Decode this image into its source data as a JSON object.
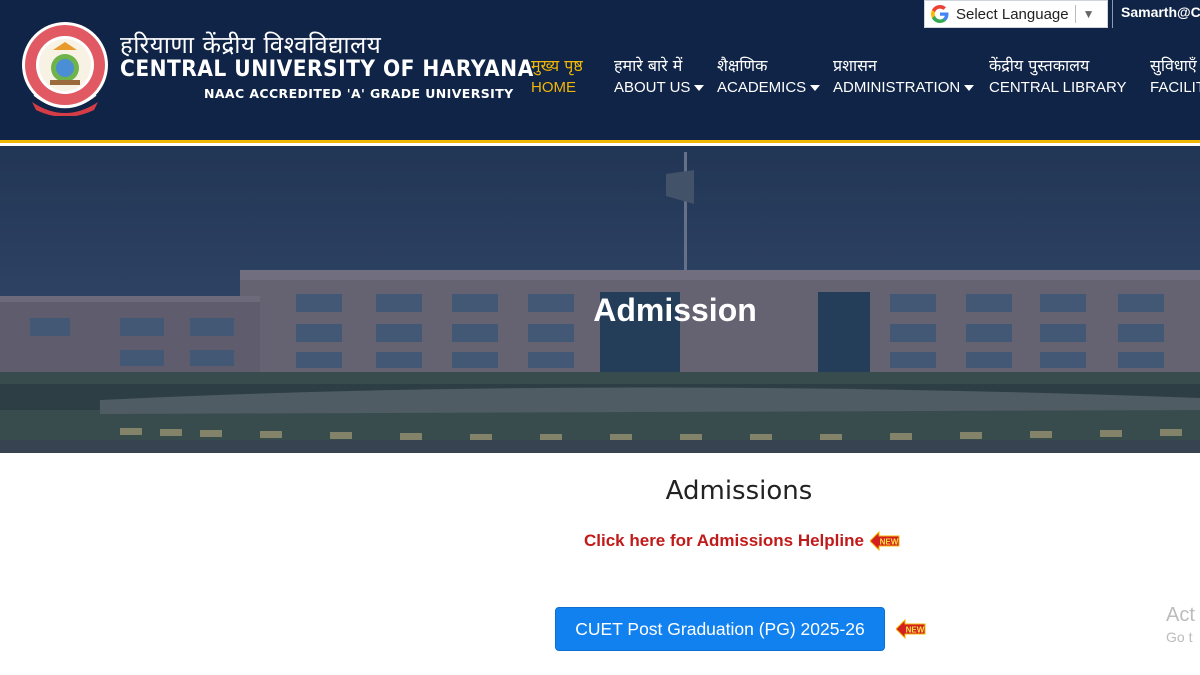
{
  "brand": {
    "name_hindi": "हरियाणा केंद्रीय विश्वविद्यालय",
    "name_english": "CENTRAL UNIVERSITY OF HARYANA",
    "accreditation": "NAAC ACCREDITED 'A' GRADE UNIVERSITY"
  },
  "topbar": {
    "language_selector": "Select Language",
    "samarth_link": "Samarth@C"
  },
  "nav": [
    {
      "hi": "मुख्य पृष्ठ",
      "en": "HOME"
    },
    {
      "hi": "हमारे बारे में",
      "en": "ABOUT US"
    },
    {
      "hi": "शैक्षणिक",
      "en": "ACADEMICS"
    },
    {
      "hi": "प्रशासन",
      "en": "ADMINISTRATION"
    },
    {
      "hi": "केंद्रीय पुस्तकालय",
      "en": "CENTRAL LIBRARY"
    },
    {
      "hi": "सुविधाएँ",
      "en": "FACILIT"
    }
  ],
  "hero": {
    "title": "Admission"
  },
  "content": {
    "section_title": "Admissions",
    "helpline_link": "Click here for Admissions Helpline",
    "new_badge": "NEW",
    "cuet_button": "CUET Post Graduation (PG) 2025-26"
  },
  "os_watermark": {
    "line1": "Act",
    "line2": "Go t"
  },
  "colors": {
    "header_bg": "#0f2446",
    "accent_gold": "#f2b705",
    "helpline_red": "#c11a1a",
    "button_blue": "#1281f0"
  }
}
